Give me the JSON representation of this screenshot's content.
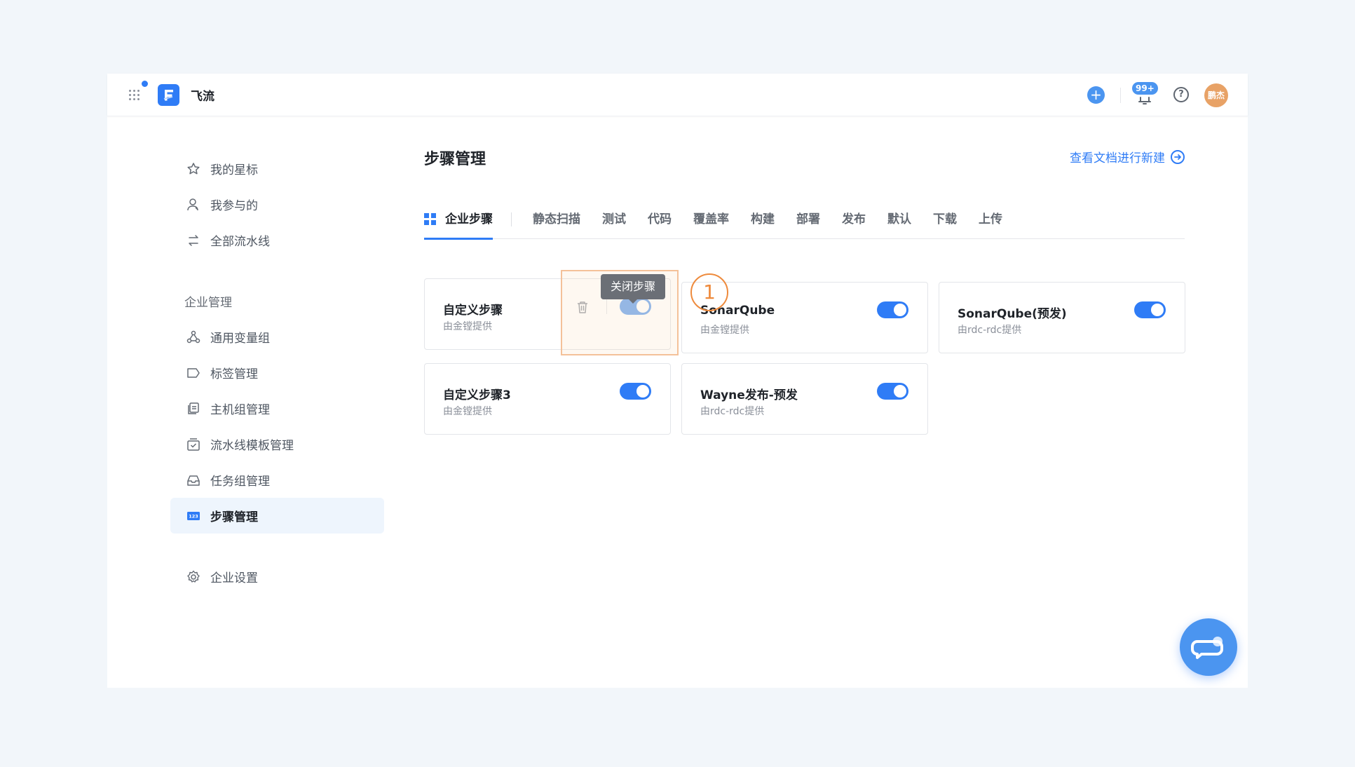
{
  "app": {
    "title": "飞流",
    "notice_count": "99+",
    "help_symbol": "?",
    "add_symbol": "+",
    "avatar_text": "鹏杰"
  },
  "sidebar": {
    "items": [
      {
        "label": "我的星标",
        "icon": "star-icon"
      },
      {
        "label": "我参与的",
        "icon": "user-icon"
      },
      {
        "label": "全部流水线",
        "icon": "swap-icon"
      }
    ],
    "group_title": "企业管理",
    "group_items": [
      {
        "label": "通用变量组",
        "icon": "nodes-icon"
      },
      {
        "label": "标签管理",
        "icon": "tag-icon"
      },
      {
        "label": "主机组管理",
        "icon": "host-icon"
      },
      {
        "label": "流水线模板管理",
        "icon": "template-icon"
      },
      {
        "label": "任务组管理",
        "icon": "inbox-icon"
      },
      {
        "label": "步骤管理",
        "icon": "step-123-icon",
        "active": true
      }
    ],
    "settings_label": "企业设置"
  },
  "main": {
    "title": "步骤管理",
    "doc_link": "查看文档进行新建",
    "tabs": [
      "企业步骤",
      "静态扫描",
      "测试",
      "代码",
      "覆盖率",
      "构建",
      "部署",
      "发布",
      "默认",
      "下载",
      "上传"
    ],
    "active_tab": "企业步骤"
  },
  "cards": [
    {
      "name": "自定义步骤",
      "provider": "由金镗提供",
      "enabled": true
    },
    {
      "name": "SonarQube",
      "provider": "由金镗提供",
      "enabled": true
    },
    {
      "name": "SonarQube(预发)",
      "provider": "由rdc-rdc提供",
      "enabled": true
    },
    {
      "name": "自定义步骤3",
      "provider": "由金镗提供",
      "enabled": true
    },
    {
      "name": "Wayne发布-预发",
      "provider": "由rdc-rdc提供",
      "enabled": true
    }
  ],
  "tooltip": "关闭步骤",
  "step_marker": "1",
  "colors": {
    "accent": "#2f7cf6",
    "highlight": "#ee8a3c",
    "page_bg": "#f2f6fa"
  }
}
